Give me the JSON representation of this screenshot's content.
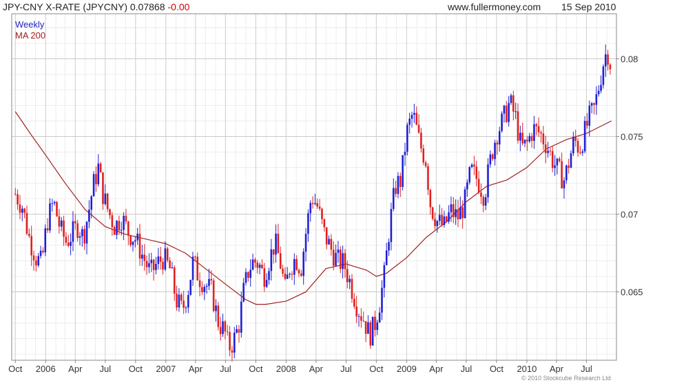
{
  "header": {
    "title": "JPY-CNY X-RATE (JPYCNY) 0.07868",
    "change": "-0.00",
    "website": "www.fullermoney.com",
    "date": "15 Sep 2010"
  },
  "legend": {
    "weekly": "Weekly",
    "ma": "MA 200"
  },
  "copyright": "© 2010 Stockcube Research Ltd",
  "colors": {
    "up": "#1f1fd6",
    "down": "#e02020",
    "ma": "#a02020",
    "grid": "#d8d8d8",
    "frame": "#888888"
  },
  "chart_data": {
    "type": "candlestick",
    "y_axis_side": "right",
    "ylim": [
      0.0606,
      0.0829
    ],
    "yticks": [
      0.065,
      0.07,
      0.075,
      0.08
    ],
    "ytick_labels": [
      "0.065",
      "0.07",
      "0.075",
      "0.08"
    ],
    "xticks": [
      {
        "label": "Oct",
        "date": "2005-10-01"
      },
      {
        "label": "2006",
        "date": "2006-01-01"
      },
      {
        "label": "Apr",
        "date": "2006-04-01"
      },
      {
        "label": "Jul",
        "date": "2006-07-01"
      },
      {
        "label": "Oct",
        "date": "2006-10-01"
      },
      {
        "label": "2007",
        "date": "2007-01-01"
      },
      {
        "label": "Apr",
        "date": "2007-04-01"
      },
      {
        "label": "Jul",
        "date": "2007-07-01"
      },
      {
        "label": "Oct",
        "date": "2007-10-01"
      },
      {
        "label": "2008",
        "date": "2008-01-01"
      },
      {
        "label": "Apr",
        "date": "2008-04-01"
      },
      {
        "label": "Jul",
        "date": "2008-07-01"
      },
      {
        "label": "Oct",
        "date": "2008-10-01"
      },
      {
        "label": "2009",
        "date": "2009-01-01"
      },
      {
        "label": "Apr",
        "date": "2009-04-01"
      },
      {
        "label": "Jul",
        "date": "2009-07-01"
      },
      {
        "label": "Oct",
        "date": "2009-10-01"
      },
      {
        "label": "2010",
        "date": "2010-01-01"
      },
      {
        "label": "Apr",
        "date": "2010-04-01"
      },
      {
        "label": "Jul",
        "date": "2010-07-01"
      }
    ],
    "close_path": [
      [
        "2005-10-01",
        0.0713
      ],
      [
        "2005-10-22",
        0.0705
      ],
      [
        "2005-11-12",
        0.0685
      ],
      [
        "2005-12-03",
        0.0672
      ],
      [
        "2005-12-20",
        0.0668
      ],
      [
        "2006-01-05",
        0.0695
      ],
      [
        "2006-01-25",
        0.0708
      ],
      [
        "2006-02-15",
        0.069
      ],
      [
        "2006-03-05",
        0.0682
      ],
      [
        "2006-03-25",
        0.0688
      ],
      [
        "2006-04-10",
        0.0693
      ],
      [
        "2006-04-25",
        0.0685
      ],
      [
        "2006-05-10",
        0.07
      ],
      [
        "2006-05-25",
        0.0718
      ],
      [
        "2006-06-10",
        0.073
      ],
      [
        "2006-06-25",
        0.0712
      ],
      [
        "2006-07-10",
        0.0702
      ],
      [
        "2006-07-30",
        0.0692
      ],
      [
        "2006-08-20",
        0.0698
      ],
      [
        "2006-09-10",
        0.0688
      ],
      [
        "2006-10-01",
        0.0684
      ],
      [
        "2006-10-25",
        0.0672
      ],
      [
        "2006-11-15",
        0.0662
      ],
      [
        "2006-12-05",
        0.0668
      ],
      [
        "2006-12-25",
        0.0672
      ],
      [
        "2007-01-15",
        0.0664
      ],
      [
        "2007-02-01",
        0.0645
      ],
      [
        "2007-02-20",
        0.0638
      ],
      [
        "2007-03-10",
        0.0652
      ],
      [
        "2007-03-25",
        0.067
      ],
      [
        "2007-04-10",
        0.066
      ],
      [
        "2007-05-01",
        0.0655
      ],
      [
        "2007-05-20",
        0.065
      ],
      [
        "2007-06-10",
        0.063
      ],
      [
        "2007-06-28",
        0.0625
      ],
      [
        "2007-07-10",
        0.0614
      ],
      [
        "2007-07-25",
        0.0618
      ],
      [
        "2007-08-10",
        0.0628
      ],
      [
        "2007-08-25",
        0.065
      ],
      [
        "2007-09-10",
        0.0665
      ],
      [
        "2007-09-25",
        0.067
      ],
      [
        "2007-10-10",
        0.0668
      ],
      [
        "2007-10-25",
        0.066
      ],
      [
        "2007-11-10",
        0.067
      ],
      [
        "2007-11-28",
        0.0682
      ],
      [
        "2007-12-15",
        0.0668
      ],
      [
        "2007-12-30",
        0.065
      ],
      [
        "2008-01-10",
        0.0665
      ],
      [
        "2008-01-30",
        0.0672
      ],
      [
        "2008-02-15",
        0.0665
      ],
      [
        "2008-03-01",
        0.0688
      ],
      [
        "2008-03-18",
        0.0712
      ],
      [
        "2008-04-05",
        0.0705
      ],
      [
        "2008-04-25",
        0.0688
      ],
      [
        "2008-05-15",
        0.0678
      ],
      [
        "2008-06-05",
        0.067
      ],
      [
        "2008-06-25",
        0.0668
      ],
      [
        "2008-07-15",
        0.0655
      ],
      [
        "2008-08-05",
        0.064
      ],
      [
        "2008-08-25",
        0.0632
      ],
      [
        "2008-09-10",
        0.0622
      ],
      [
        "2008-09-25",
        0.0628
      ],
      [
        "2008-10-10",
        0.0642
      ],
      [
        "2008-10-25",
        0.066
      ],
      [
        "2008-11-10",
        0.0692
      ],
      [
        "2008-11-28",
        0.0718
      ],
      [
        "2008-12-15",
        0.0722
      ],
      [
        "2009-01-01",
        0.0752
      ],
      [
        "2009-01-20",
        0.0765
      ],
      [
        "2009-02-10",
        0.0745
      ],
      [
        "2009-02-28",
        0.0735
      ],
      [
        "2009-03-15",
        0.0705
      ],
      [
        "2009-04-05",
        0.0695
      ],
      [
        "2009-04-25",
        0.0692
      ],
      [
        "2009-05-15",
        0.0702
      ],
      [
        "2009-06-05",
        0.0698
      ],
      [
        "2009-06-25",
        0.0706
      ],
      [
        "2009-07-15",
        0.0728
      ],
      [
        "2009-08-05",
        0.0722
      ],
      [
        "2009-08-25",
        0.0712
      ],
      [
        "2009-09-15",
        0.0738
      ],
      [
        "2009-10-01",
        0.0752
      ],
      [
        "2009-10-20",
        0.076
      ],
      [
        "2009-11-10",
        0.0772
      ],
      [
        "2009-11-28",
        0.0762
      ],
      [
        "2009-12-15",
        0.0742
      ],
      [
        "2010-01-01",
        0.0745
      ],
      [
        "2010-01-20",
        0.0755
      ],
      [
        "2010-02-10",
        0.0752
      ],
      [
        "2010-03-01",
        0.0745
      ],
      [
        "2010-03-20",
        0.0735
      ],
      [
        "2010-04-05",
        0.0728
      ],
      [
        "2010-04-25",
        0.0722
      ],
      [
        "2010-05-10",
        0.0735
      ],
      [
        "2010-05-25",
        0.0748
      ],
      [
        "2010-06-10",
        0.0742
      ],
      [
        "2010-06-25",
        0.0752
      ],
      [
        "2010-07-10",
        0.0762
      ],
      [
        "2010-07-25",
        0.0768
      ],
      [
        "2010-08-10",
        0.0785
      ],
      [
        "2010-08-25",
        0.0802
      ],
      [
        "2010-09-08",
        0.0805
      ],
      [
        "2010-09-15",
        0.0787
      ]
    ],
    "ma_path": [
      [
        "2005-10-01",
        0.0766
      ],
      [
        "2005-11-15",
        0.0752
      ],
      [
        "2006-01-01",
        0.0738
      ],
      [
        "2006-03-01",
        0.072
      ],
      [
        "2006-05-01",
        0.0703
      ],
      [
        "2006-07-01",
        0.0692
      ],
      [
        "2006-09-01",
        0.0687
      ],
      [
        "2006-11-01",
        0.0684
      ],
      [
        "2007-01-01",
        0.0681
      ],
      [
        "2007-03-01",
        0.0675
      ],
      [
        "2007-05-01",
        0.0665
      ],
      [
        "2007-07-01",
        0.0655
      ],
      [
        "2007-09-01",
        0.0645
      ],
      [
        "2007-10-01",
        0.0642
      ],
      [
        "2007-11-01",
        0.0642
      ],
      [
        "2008-01-01",
        0.0644
      ],
      [
        "2008-03-01",
        0.065
      ],
      [
        "2008-05-01",
        0.0665
      ],
      [
        "2008-07-01",
        0.0668
      ],
      [
        "2008-09-01",
        0.0664
      ],
      [
        "2008-10-01",
        0.066
      ],
      [
        "2008-11-01",
        0.0662
      ],
      [
        "2009-01-01",
        0.0672
      ],
      [
        "2009-03-01",
        0.0685
      ],
      [
        "2009-05-01",
        0.0695
      ],
      [
        "2009-07-01",
        0.0708
      ],
      [
        "2009-09-01",
        0.0718
      ],
      [
        "2009-11-01",
        0.0722
      ],
      [
        "2010-01-01",
        0.073
      ],
      [
        "2010-03-01",
        0.0742
      ],
      [
        "2010-05-01",
        0.0748
      ],
      [
        "2010-07-01",
        0.0752
      ],
      [
        "2010-09-15",
        0.076
      ]
    ]
  }
}
